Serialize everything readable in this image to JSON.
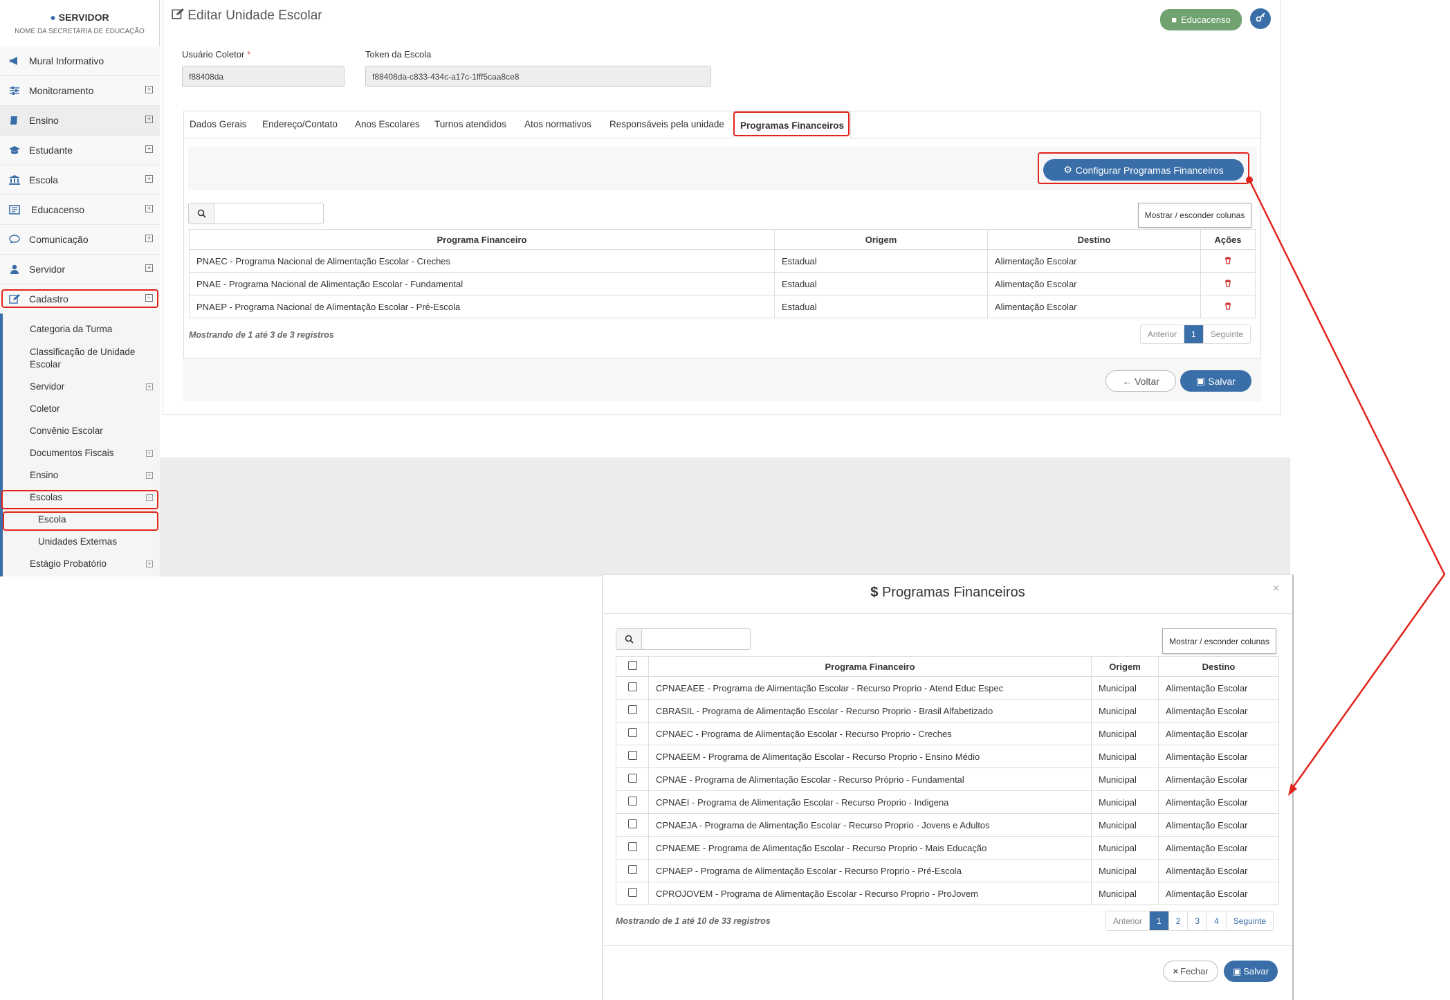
{
  "user": {
    "name": "SERVIDOR",
    "subtitle": "NOME DA SECRETARIA DE EDUCAÇÃO"
  },
  "sidebar": {
    "items": [
      {
        "label": "Mural Informativo",
        "icon": "megaphone-icon"
      },
      {
        "label": "Monitoramento",
        "icon": "sliders-icon"
      },
      {
        "label": "Ensino",
        "icon": "book-icon"
      },
      {
        "label": "Estudante",
        "icon": "graduation-cap-icon"
      },
      {
        "label": "Escola",
        "icon": "institution-icon"
      },
      {
        "label": "Educacenso",
        "icon": "newspaper-icon"
      },
      {
        "label": "Comunicação",
        "icon": "speech-bubble-icon"
      },
      {
        "label": "Servidor",
        "icon": "user-icon"
      },
      {
        "label": "Cadastro",
        "icon": "edit-icon"
      }
    ],
    "cadastro_sub": [
      "Categoria da Turma",
      "Classificação de Unidade",
      "Escolar",
      "Servidor",
      "Coletor",
      "Convênio Escolar",
      "Documentos Fiscais",
      "Ensino",
      "Escolas",
      "Escola",
      "Unidades Externas",
      "Estágio Probatório"
    ]
  },
  "header": {
    "title": "Editar Unidade Escolar",
    "educacenso_btn": "Educacenso"
  },
  "form": {
    "usuario_label": "Usuário Coletor",
    "required_mark": "*",
    "usuario_value": "f88408da",
    "token_label": "Token da Escola",
    "token_value": "f88408da-c833-434c-a17c-1fff5caa8ce8"
  },
  "tabs": [
    "Dados Gerais",
    "Endereço/Contato",
    "Anos Escolares",
    "Turnos atendidos",
    "Atos normativos",
    "Responsáveis pela unidade",
    "Programas Financeiros"
  ],
  "programs": {
    "config_btn": "Configurar Programas Financeiros",
    "columns_btn": "Mostrar / esconder colunas",
    "headers": [
      "Programa Financeiro",
      "Origem",
      "Destino",
      "Ações"
    ],
    "rows": [
      [
        "PNAEC - Programa Nacional de Alimentação Escolar - Creches",
        "Estadual",
        "Alimentação Escolar"
      ],
      [
        "PNAE - Programa Nacional de Alimentação Escolar - Fundamental",
        "Estadual",
        "Alimentação Escolar"
      ],
      [
        "PNAEP - Programa Nacional de Alimentação Escolar - Pré-Escola",
        "Estadual",
        "Alimentação Escolar"
      ]
    ],
    "info": "Mostrando de 1 até 3 de 3 registros",
    "pag": [
      "Anterior",
      "1",
      "Seguinte"
    ],
    "back_btn": "Voltar",
    "save_btn": "Salvar"
  },
  "modal": {
    "title": "Programas Financeiros",
    "title_icon": "$",
    "close": "×",
    "columns_btn": "Mostrar / esconder colunas",
    "headers": [
      "Programa Financeiro",
      "Origem",
      "Destino"
    ],
    "rows": [
      [
        "CPNAEAEE - Programa de Alimentação Escolar - Recurso Proprio - Atend Educ Espec",
        "Municipal",
        "Alimentação Escolar"
      ],
      [
        "CBRASIL - Programa de Alimentação Escolar - Recurso Proprio - Brasil Alfabetizado",
        "Municipal",
        "Alimentação Escolar"
      ],
      [
        "CPNAEC - Programa de Alimentação Escolar - Recurso Proprio - Creches",
        "Municipal",
        "Alimentação Escolar"
      ],
      [
        "CPNAEEM - Programa de Alimentação Escolar - Recurso Proprio - Ensino Médio",
        "Municipal",
        "Alimentação Escolar"
      ],
      [
        "CPNAE - Programa de Alimentação Escolar - Recurso Próprio - Fundamental",
        "Municipal",
        "Alimentação Escolar"
      ],
      [
        "CPNAEI - Programa de Alimentação Escolar - Recurso Proprio - Indigena",
        "Municipal",
        "Alimentação Escolar"
      ],
      [
        "CPNAEJA - Programa de Alimentação Escolar - Recurso Proprio - Jovens e Adultos",
        "Municipal",
        "Alimentação Escolar"
      ],
      [
        "CPNAEME - Programa de Alimentação Escolar - Recurso Proprio - Mais Educação",
        "Municipal",
        "Alimentação Escolar"
      ],
      [
        "CPNAEP - Programa de Alimentação Escolar - Recurso Proprio - Pré-Escola",
        "Municipal",
        "Alimentação Escolar"
      ],
      [
        "CPROJOVEM - Programa de Alimentação Escolar - Recurso Proprio - ProJovem",
        "Municipal",
        "Alimentação Escolar"
      ]
    ],
    "info": "Mostrando de 1 até 10 de 33 registros",
    "pag": [
      "Anterior",
      "1",
      "2",
      "3",
      "4",
      "Seguinte"
    ],
    "close_btn": "Fechar",
    "save_btn": "Salvar"
  },
  "colors": {
    "primary": "#3a6ea8",
    "green": "#6fa26f",
    "highlight": "#e2231a"
  }
}
